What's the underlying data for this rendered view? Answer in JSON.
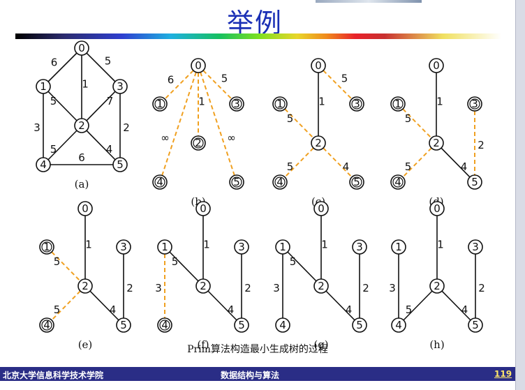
{
  "slide": {
    "title": "举例",
    "caption": "Prim算法构造最小生成树的过程",
    "footer": {
      "left": "北京大学信息科学技术学院",
      "center": "数据结构与算法",
      "page": "119"
    }
  },
  "colors": {
    "title": "#1a2fb5",
    "candidate_edge": "#f0a020",
    "footer_bg": "#2a2d86"
  },
  "diagrams": [
    {
      "label": "(a)",
      "edges": [
        {
          "u": "0",
          "v": "1",
          "w": "6",
          "style": "solid"
        },
        {
          "u": "0",
          "v": "3",
          "w": "5",
          "style": "solid"
        },
        {
          "u": "0",
          "v": "2",
          "w": "1",
          "style": "solid"
        },
        {
          "u": "1",
          "v": "2",
          "w": "5",
          "style": "solid"
        },
        {
          "u": "2",
          "v": "3",
          "w": "7",
          "style": "solid"
        },
        {
          "u": "1",
          "v": "4",
          "w": "3",
          "style": "solid"
        },
        {
          "u": "2",
          "v": "4",
          "w": "5",
          "style": "solid"
        },
        {
          "u": "3",
          "v": "5",
          "w": "2",
          "style": "solid"
        },
        {
          "u": "2",
          "v": "5",
          "w": "4",
          "style": "solid"
        },
        {
          "u": "4",
          "v": "5",
          "w": "6",
          "style": "solid"
        }
      ],
      "ringed": []
    },
    {
      "label": "(b)",
      "edges": [
        {
          "u": "0",
          "v": "1",
          "w": "6",
          "style": "dashed"
        },
        {
          "u": "0",
          "v": "2",
          "w": "1",
          "style": "dashed"
        },
        {
          "u": "0",
          "v": "3",
          "w": "5",
          "style": "dashed"
        },
        {
          "u": "0",
          "v": "4",
          "w": "∞",
          "style": "dashed"
        },
        {
          "u": "0",
          "v": "5",
          "w": "∞",
          "style": "dashed"
        }
      ],
      "ringed": [
        "1",
        "2",
        "3",
        "4",
        "5"
      ]
    },
    {
      "label": "(c)",
      "edges": [
        {
          "u": "0",
          "v": "2",
          "w": "1",
          "style": "solid"
        },
        {
          "u": "0",
          "v": "3",
          "w": "5",
          "style": "dashed"
        },
        {
          "u": "1",
          "v": "2",
          "w": "5",
          "style": "dashed"
        },
        {
          "u": "2",
          "v": "4",
          "w": "5",
          "style": "dashed"
        },
        {
          "u": "2",
          "v": "5",
          "w": "4",
          "style": "dashed"
        }
      ],
      "ringed": [
        "1",
        "3",
        "4",
        "5"
      ]
    },
    {
      "label": "(d)",
      "edges": [
        {
          "u": "0",
          "v": "2",
          "w": "1",
          "style": "solid"
        },
        {
          "u": "2",
          "v": "5",
          "w": "4",
          "style": "solid"
        },
        {
          "u": "1",
          "v": "2",
          "w": "5",
          "style": "dashed"
        },
        {
          "u": "2",
          "v": "4",
          "w": "5",
          "style": "dashed"
        },
        {
          "u": "3",
          "v": "5",
          "w": "2",
          "style": "dashed"
        }
      ],
      "ringed": [
        "1",
        "3",
        "4"
      ]
    },
    {
      "label": "(e)",
      "edges": [
        {
          "u": "0",
          "v": "2",
          "w": "1",
          "style": "solid"
        },
        {
          "u": "2",
          "v": "5",
          "w": "4",
          "style": "solid"
        },
        {
          "u": "3",
          "v": "5",
          "w": "2",
          "style": "solid"
        },
        {
          "u": "1",
          "v": "2",
          "w": "5",
          "style": "dashed"
        },
        {
          "u": "2",
          "v": "4",
          "w": "5",
          "style": "dashed"
        }
      ],
      "ringed": [
        "1",
        "4"
      ]
    },
    {
      "label": "(f)",
      "edges": [
        {
          "u": "0",
          "v": "2",
          "w": "1",
          "style": "solid"
        },
        {
          "u": "2",
          "v": "5",
          "w": "4",
          "style": "solid"
        },
        {
          "u": "3",
          "v": "5",
          "w": "2",
          "style": "solid"
        },
        {
          "u": "1",
          "v": "2",
          "w": "5",
          "style": "solid"
        },
        {
          "u": "1",
          "v": "4",
          "w": "3",
          "style": "dashed"
        }
      ],
      "ringed": [
        "4"
      ]
    },
    {
      "label": "(g)",
      "edges": [
        {
          "u": "0",
          "v": "2",
          "w": "1",
          "style": "solid"
        },
        {
          "u": "2",
          "v": "5",
          "w": "4",
          "style": "solid"
        },
        {
          "u": "3",
          "v": "5",
          "w": "2",
          "style": "solid"
        },
        {
          "u": "1",
          "v": "2",
          "w": "5",
          "style": "solid"
        },
        {
          "u": "1",
          "v": "4",
          "w": "3",
          "style": "solid"
        }
      ],
      "ringed": []
    },
    {
      "label": "(h)",
      "edges": [
        {
          "u": "0",
          "v": "2",
          "w": "1",
          "style": "solid"
        },
        {
          "u": "2",
          "v": "5",
          "w": "4",
          "style": "solid"
        },
        {
          "u": "3",
          "v": "5",
          "w": "2",
          "style": "solid"
        },
        {
          "u": "2",
          "v": "4",
          "w": "5",
          "style": "solid"
        },
        {
          "u": "1",
          "v": "4",
          "w": "3",
          "style": "solid"
        }
      ],
      "ringed": []
    }
  ]
}
